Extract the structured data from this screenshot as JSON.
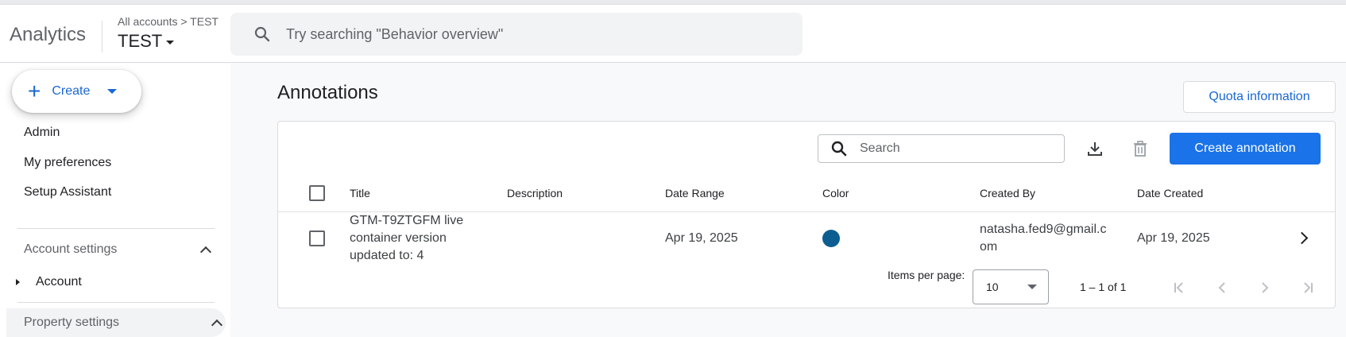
{
  "header": {
    "brand": "Analytics",
    "breadcrumb": "All accounts > TEST",
    "property": "TEST",
    "search_placeholder": "Try searching \"Behavior overview\""
  },
  "sidebar": {
    "create_label": "Create",
    "items": [
      "Admin",
      "My preferences",
      "Setup Assistant"
    ],
    "account_settings": "Account settings",
    "account": "Account",
    "property_settings": "Property settings"
  },
  "page": {
    "title": "Annotations",
    "quota_label": "Quota information"
  },
  "table": {
    "search_placeholder": "Search",
    "create_label": "Create annotation",
    "columns": [
      "Title",
      "Description",
      "Date Range",
      "Color",
      "Created By",
      "Date Created"
    ],
    "rows": [
      {
        "title_lines": [
          "GTM-T9ZTGFM live",
          "container version",
          "updated to: 4"
        ],
        "description": "",
        "date_range": "Apr 19, 2025",
        "color": "#0b5e8f",
        "created_by_lines": [
          "natasha.fed9@gmail.c",
          "om"
        ],
        "date_created": "Apr 19, 2025"
      }
    ],
    "items_per_page_label": "Items per page:",
    "items_per_page": "10",
    "range_text": "1 – 1 of 1"
  },
  "icons": {
    "search": "search-icon",
    "download": "download-icon",
    "delete": "trash-icon",
    "pagination": [
      "first-page-icon",
      "prev-page-icon",
      "next-page-icon",
      "last-page-icon"
    ]
  },
  "colors": {
    "accent": "#1a73e8",
    "link": "#1967d2"
  }
}
